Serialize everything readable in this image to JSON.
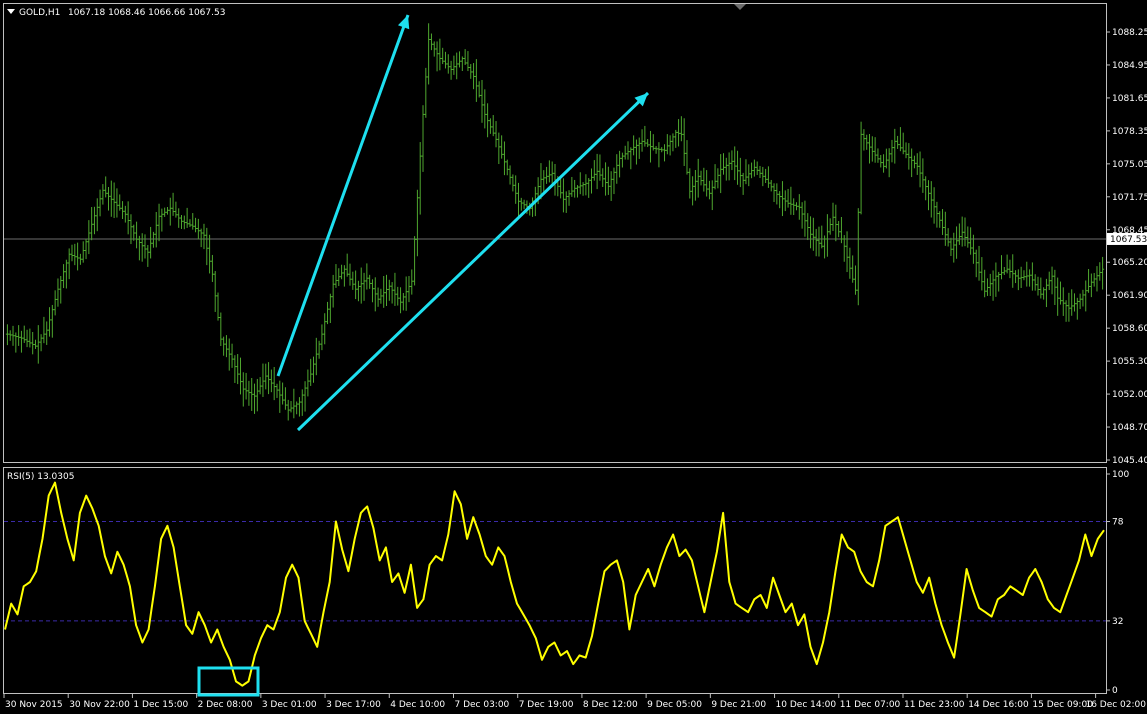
{
  "window": {
    "symbol_header": "GOLD,H1",
    "ohlc_header": "1067.18 1068.46 1066.66 1067.53",
    "rsi_header": "RSI(5) 13.0305"
  },
  "colors": {
    "background": "#000000",
    "grid_border": "#c0c0c0",
    "bar_color": "#4fa82f",
    "rsi_line": "#ffff00",
    "rsi_level": "#3a2aa8",
    "arrow": "#1ee0f0",
    "bid_line": "#6b6b6b"
  },
  "chart_data": [
    {
      "type": "ohlc",
      "title": "GOLD,H1",
      "ylim": [
        1045.4,
        1090.0
      ],
      "y_ticks": [
        "1088.25",
        "1084.95",
        "1081.65",
        "1078.35",
        "1075.05",
        "1071.75",
        "1068.45",
        "1065.20",
        "1061.90",
        "1058.60",
        "1055.30",
        "1052.00",
        "1048.70",
        "1045.40"
      ],
      "current_price": "1067.53",
      "anchors": [
        [
          0,
          1058
        ],
        [
          5,
          1057.6
        ],
        [
          10,
          1056.8
        ],
        [
          14,
          1058.4
        ],
        [
          18,
          1062.5
        ],
        [
          22,
          1066.0
        ],
        [
          26,
          1065.5
        ],
        [
          30,
          1069.0
        ],
        [
          34,
          1072.4
        ],
        [
          38,
          1071.2
        ],
        [
          42,
          1070.0
        ],
        [
          46,
          1067.5
        ],
        [
          50,
          1066.2
        ],
        [
          54,
          1069.8
        ],
        [
          58,
          1070.6
        ],
        [
          62,
          1069.3
        ],
        [
          66,
          1068.8
        ],
        [
          70,
          1067.9
        ],
        [
          73,
          1064.0
        ],
        [
          76,
          1057.5
        ],
        [
          80,
          1055.5
        ],
        [
          84,
          1052.5
        ],
        [
          88,
          1051.8
        ],
        [
          92,
          1053.8
        ],
        [
          96,
          1052.4
        ],
        [
          100,
          1050.4
        ],
        [
          104,
          1051.2
        ],
        [
          108,
          1054.0
        ],
        [
          112,
          1058.0
        ],
        [
          116,
          1063.0
        ],
        [
          120,
          1064.5
        ],
        [
          124,
          1062.5
        ],
        [
          128,
          1063.6
        ],
        [
          132,
          1061.5
        ],
        [
          136,
          1062.8
        ],
        [
          140,
          1061.2
        ],
        [
          144,
          1063.3
        ],
        [
          148,
          1080.0
        ],
        [
          150,
          1087.5
        ],
        [
          154,
          1085.6
        ],
        [
          158,
          1084.5
        ],
        [
          162,
          1085.6
        ],
        [
          166,
          1083.8
        ],
        [
          170,
          1080.0
        ],
        [
          174,
          1077.5
        ],
        [
          178,
          1074.5
        ],
        [
          182,
          1071.3
        ],
        [
          186,
          1070.6
        ],
        [
          190,
          1073.5
        ],
        [
          194,
          1074.1
        ],
        [
          198,
          1071.5
        ],
        [
          202,
          1072.6
        ],
        [
          206,
          1073.1
        ],
        [
          210,
          1074.3
        ],
        [
          214,
          1072.8
        ],
        [
          218,
          1075.6
        ],
        [
          222,
          1076.5
        ],
        [
          226,
          1077.3
        ],
        [
          230,
          1076.6
        ],
        [
          234,
          1076.4
        ],
        [
          238,
          1078.2
        ],
        [
          240,
          1078.0
        ],
        [
          243,
          1072.3
        ],
        [
          246,
          1073.8
        ],
        [
          250,
          1072.1
        ],
        [
          254,
          1074.5
        ],
        [
          258,
          1075.3
        ],
        [
          262,
          1073.4
        ],
        [
          266,
          1074.7
        ],
        [
          270,
          1073.5
        ],
        [
          274,
          1072.0
        ],
        [
          278,
          1071.1
        ],
        [
          282,
          1070.7
        ],
        [
          286,
          1068.0
        ],
        [
          290,
          1066.8
        ],
        [
          294,
          1069.7
        ],
        [
          298,
          1066.8
        ],
        [
          302,
          1062.4
        ],
        [
          304,
          1078.0
        ],
        [
          308,
          1076.3
        ],
        [
          312,
          1074.8
        ],
        [
          316,
          1077.3
        ],
        [
          320,
          1076.0
        ],
        [
          324,
          1074.8
        ],
        [
          328,
          1072.1
        ],
        [
          332,
          1069.4
        ],
        [
          336,
          1066.5
        ],
        [
          340,
          1068.2
        ],
        [
          344,
          1066.1
        ],
        [
          348,
          1062.3
        ],
        [
          352,
          1063.8
        ],
        [
          356,
          1064.5
        ],
        [
          360,
          1063.6
        ],
        [
          364,
          1063.9
        ],
        [
          368,
          1062.0
        ],
        [
          372,
          1063.8
        ],
        [
          374,
          1061.6
        ],
        [
          378,
          1060.6
        ],
        [
          382,
          1061.5
        ],
        [
          386,
          1063.2
        ],
        [
          390,
          1064.5
        ]
      ],
      "x_range": [
        0,
        390
      ]
    },
    {
      "type": "line",
      "title": "RSI(5) 13.0305",
      "ylim": [
        0,
        100
      ],
      "levels": [
        78,
        32
      ],
      "y_ticks": [
        "100",
        "78",
        "32",
        "0"
      ],
      "anchors": [
        [
          0,
          28
        ],
        [
          2,
          40
        ],
        [
          4,
          35
        ],
        [
          6,
          48
        ],
        [
          8,
          50
        ],
        [
          10,
          55
        ],
        [
          12,
          70
        ],
        [
          14,
          90
        ],
        [
          16,
          96
        ],
        [
          18,
          82
        ],
        [
          20,
          70
        ],
        [
          22,
          60
        ],
        [
          24,
          82
        ],
        [
          26,
          90
        ],
        [
          28,
          84
        ],
        [
          30,
          76
        ],
        [
          32,
          62
        ],
        [
          34,
          54
        ],
        [
          36,
          64
        ],
        [
          38,
          58
        ],
        [
          40,
          48
        ],
        [
          42,
          30
        ],
        [
          44,
          22
        ],
        [
          46,
          28
        ],
        [
          48,
          48
        ],
        [
          50,
          70
        ],
        [
          52,
          76
        ],
        [
          54,
          66
        ],
        [
          56,
          48
        ],
        [
          58,
          30
        ],
        [
          60,
          26
        ],
        [
          62,
          36
        ],
        [
          64,
          30
        ],
        [
          66,
          22
        ],
        [
          68,
          28
        ],
        [
          70,
          20
        ],
        [
          72,
          14
        ],
        [
          74,
          4
        ],
        [
          76,
          2
        ],
        [
          78,
          4
        ],
        [
          80,
          16
        ],
        [
          82,
          24
        ],
        [
          84,
          30
        ],
        [
          86,
          28
        ],
        [
          88,
          36
        ],
        [
          90,
          52
        ],
        [
          92,
          58
        ],
        [
          94,
          52
        ],
        [
          96,
          32
        ],
        [
          98,
          26
        ],
        [
          100,
          20
        ],
        [
          102,
          36
        ],
        [
          104,
          50
        ],
        [
          106,
          78
        ],
        [
          108,
          65
        ],
        [
          110,
          55
        ],
        [
          112,
          70
        ],
        [
          114,
          82
        ],
        [
          116,
          85
        ],
        [
          118,
          75
        ],
        [
          120,
          60
        ],
        [
          122,
          66
        ],
        [
          124,
          50
        ],
        [
          126,
          54
        ],
        [
          128,
          45
        ],
        [
          130,
          58
        ],
        [
          132,
          38
        ],
        [
          134,
          42
        ],
        [
          136,
          58
        ],
        [
          138,
          62
        ],
        [
          140,
          60
        ],
        [
          142,
          72
        ],
        [
          144,
          92
        ],
        [
          146,
          86
        ],
        [
          148,
          70
        ],
        [
          150,
          80
        ],
        [
          152,
          72
        ],
        [
          154,
          62
        ],
        [
          156,
          58
        ],
        [
          158,
          66
        ],
        [
          160,
          62
        ],
        [
          162,
          50
        ],
        [
          164,
          40
        ],
        [
          166,
          35
        ],
        [
          168,
          30
        ],
        [
          170,
          24
        ],
        [
          172,
          14
        ],
        [
          174,
          20
        ],
        [
          176,
          22
        ],
        [
          178,
          16
        ],
        [
          180,
          18
        ],
        [
          182,
          12
        ],
        [
          184,
          16
        ],
        [
          186,
          15
        ],
        [
          188,
          25
        ],
        [
          190,
          40
        ],
        [
          192,
          55
        ],
        [
          194,
          58
        ],
        [
          196,
          60
        ],
        [
          198,
          50
        ],
        [
          200,
          28
        ],
        [
          202,
          44
        ],
        [
          204,
          50
        ],
        [
          206,
          56
        ],
        [
          208,
          48
        ],
        [
          210,
          58
        ],
        [
          212,
          66
        ],
        [
          214,
          72
        ],
        [
          216,
          62
        ],
        [
          218,
          65
        ],
        [
          220,
          60
        ],
        [
          222,
          48
        ],
        [
          224,
          36
        ],
        [
          226,
          50
        ],
        [
          228,
          64
        ],
        [
          230,
          82
        ],
        [
          232,
          50
        ],
        [
          234,
          40
        ],
        [
          236,
          38
        ],
        [
          238,
          36
        ],
        [
          240,
          42
        ],
        [
          242,
          44
        ],
        [
          244,
          38
        ],
        [
          246,
          52
        ],
        [
          248,
          44
        ],
        [
          250,
          36
        ],
        [
          252,
          40
        ],
        [
          254,
          30
        ],
        [
          256,
          35
        ],
        [
          258,
          20
        ],
        [
          260,
          12
        ],
        [
          262,
          22
        ],
        [
          264,
          36
        ],
        [
          266,
          55
        ],
        [
          268,
          72
        ],
        [
          270,
          66
        ],
        [
          272,
          64
        ],
        [
          274,
          55
        ],
        [
          276,
          50
        ],
        [
          278,
          48
        ],
        [
          280,
          60
        ],
        [
          282,
          76
        ],
        [
          284,
          78
        ],
        [
          286,
          80
        ],
        [
          288,
          70
        ],
        [
          290,
          60
        ],
        [
          292,
          50
        ],
        [
          294,
          45
        ],
        [
          296,
          52
        ],
        [
          298,
          40
        ],
        [
          300,
          30
        ],
        [
          302,
          22
        ],
        [
          304,
          15
        ],
        [
          306,
          35
        ],
        [
          308,
          56
        ],
        [
          310,
          46
        ],
        [
          312,
          38
        ],
        [
          314,
          36
        ],
        [
          316,
          34
        ],
        [
          318,
          42
        ],
        [
          320,
          44
        ],
        [
          322,
          48
        ],
        [
          324,
          46
        ],
        [
          326,
          44
        ],
        [
          328,
          52
        ],
        [
          330,
          56
        ],
        [
          332,
          50
        ],
        [
          334,
          42
        ],
        [
          336,
          38
        ],
        [
          338,
          36
        ],
        [
          340,
          44
        ],
        [
          342,
          52
        ],
        [
          344,
          60
        ],
        [
          346,
          72
        ],
        [
          348,
          62
        ],
        [
          350,
          70
        ],
        [
          352,
          74
        ]
      ],
      "x_range": [
        0,
        352
      ]
    }
  ],
  "x_axis": {
    "labels": [
      "30 Nov 2015",
      "30 Nov 22:00",
      "1 Dec 15:00",
      "2 Dec 08:00",
      "3 Dec 01:00",
      "3 Dec 17:00",
      "4 Dec 10:00",
      "7 Dec 03:00",
      "7 Dec 19:00",
      "8 Dec 12:00",
      "9 Dec 05:00",
      "9 Dec 21:00",
      "10 Dec 14:00",
      "11 Dec 07:00",
      "11 Dec 23:00",
      "14 Dec 16:00",
      "15 Dec 09:00",
      "16 Dec 02:00"
    ]
  }
}
